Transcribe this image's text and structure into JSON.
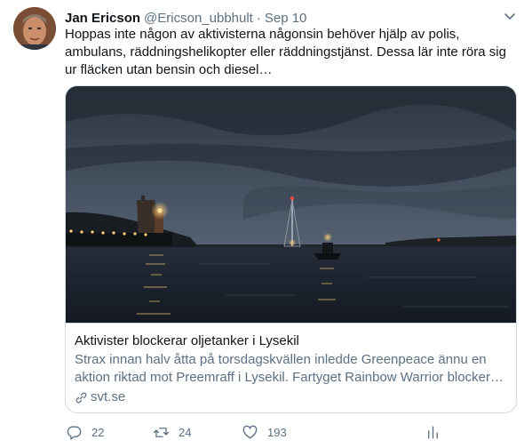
{
  "tweet": {
    "author_name": "Jan Ericson",
    "author_handle": "@Ericson_ubbhult",
    "separator": "·",
    "date": "Sep 10",
    "text": "Hoppas inte någon av aktivisterna någonsin behöver hjälp av polis, ambulans, räddningshelikopter eller räddningstjänst. Dessa lär inte röra sig ur fläcken utan bensin och diesel…"
  },
  "card": {
    "title": "Aktivister blockerar oljetanker i Lysekil",
    "description_line1": "Strax innan halv åtta på torsdagskvällen inledde Greenpeace ännu en",
    "description_line2": "aktion riktad mot Preemraff i Lysekil. Fartyget Rainbow Warrior blockera…",
    "domain": "svt.se"
  },
  "actions": {
    "replies": "22",
    "retweets": "24",
    "likes": "193"
  },
  "icons": {
    "more": "chevron-down-icon",
    "link": "link-icon",
    "reply": "reply-icon",
    "retweet": "retweet-icon",
    "like": "heart-icon",
    "share": "share-icon"
  },
  "colors": {
    "text_primary": "#0f1419",
    "text_secondary": "#5b7083",
    "border": "#cfd9de"
  }
}
